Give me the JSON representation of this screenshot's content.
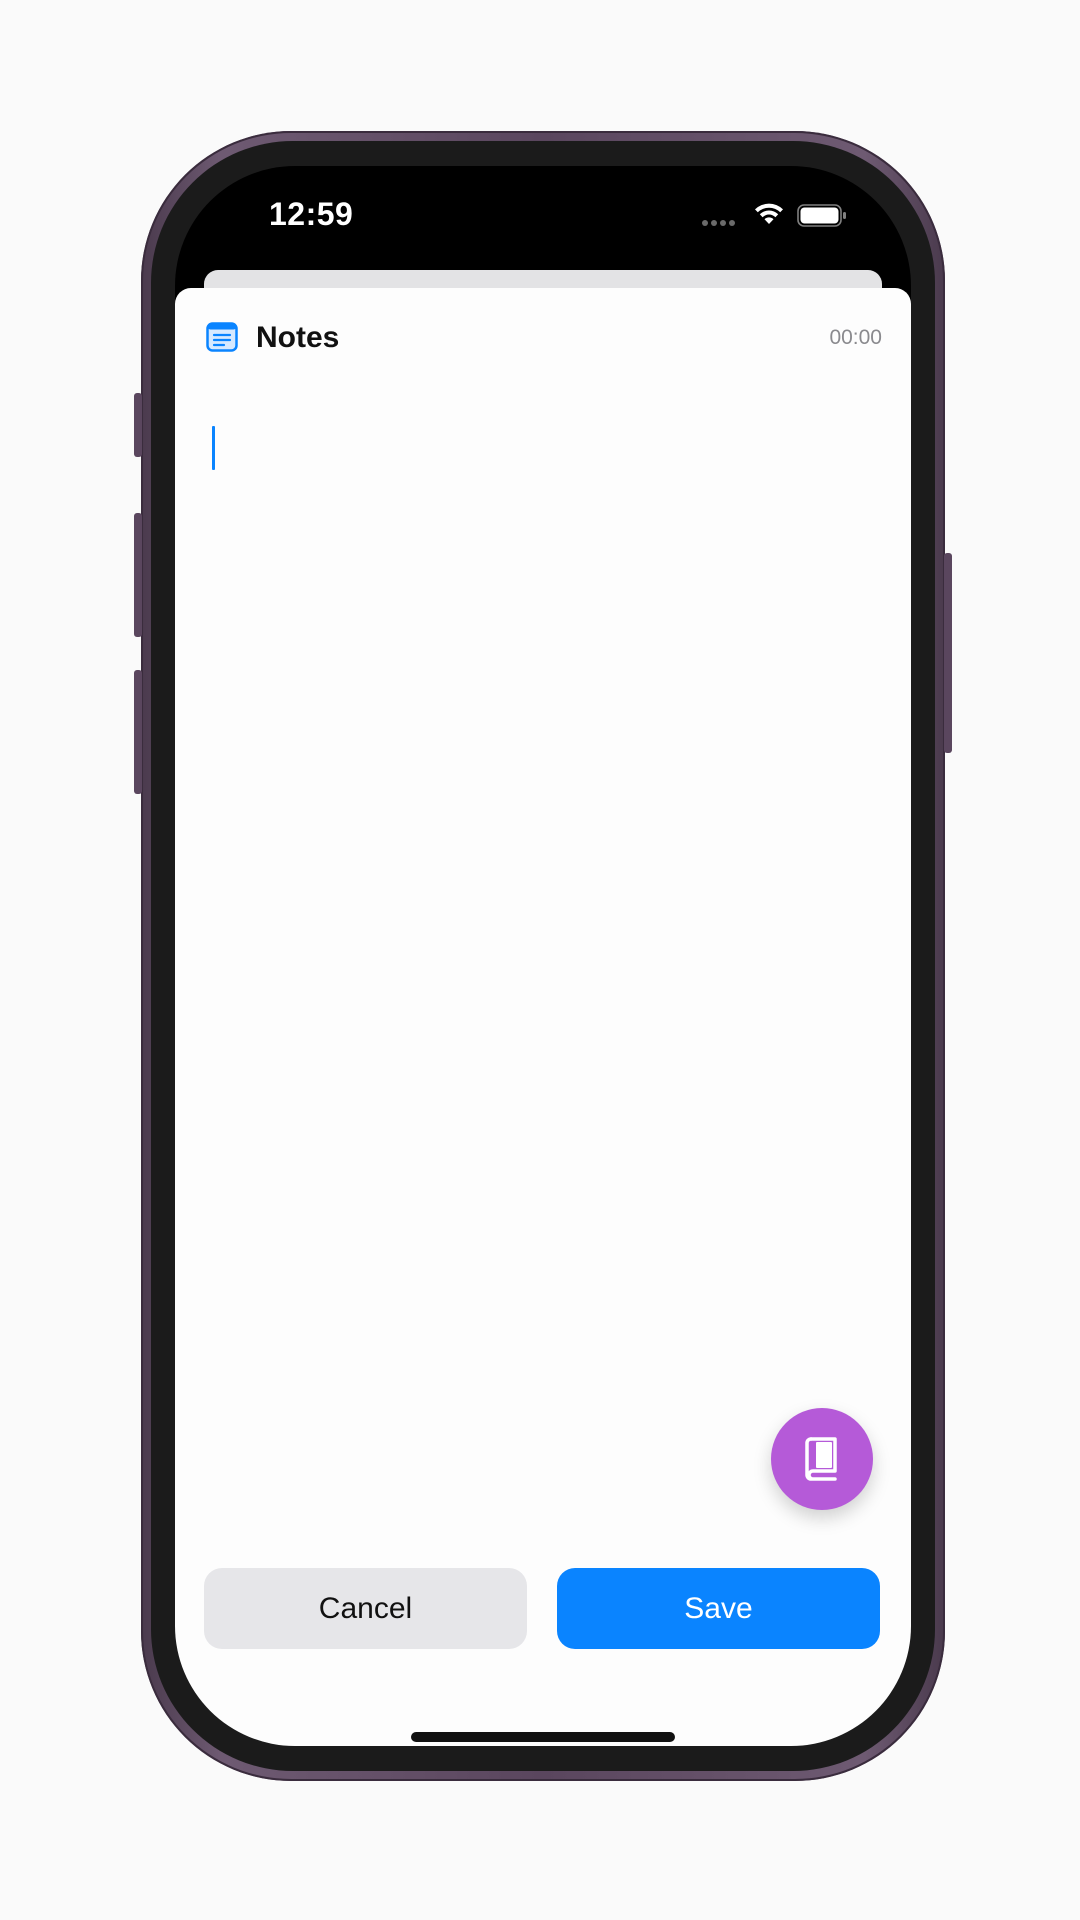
{
  "status_bar": {
    "time": "12:59"
  },
  "header": {
    "title": "Notes",
    "timer": "00:00",
    "icon": "notes-list-icon"
  },
  "editor": {
    "value": "",
    "placeholder": ""
  },
  "fab": {
    "icon": "book-icon",
    "color": "#b55ad8"
  },
  "actions": {
    "cancel_label": "Cancel",
    "save_label": "Save"
  },
  "colors": {
    "accent": "#0a84ff",
    "cancel_bg": "#e6e6e9",
    "phone_frame": "#5a465e"
  }
}
